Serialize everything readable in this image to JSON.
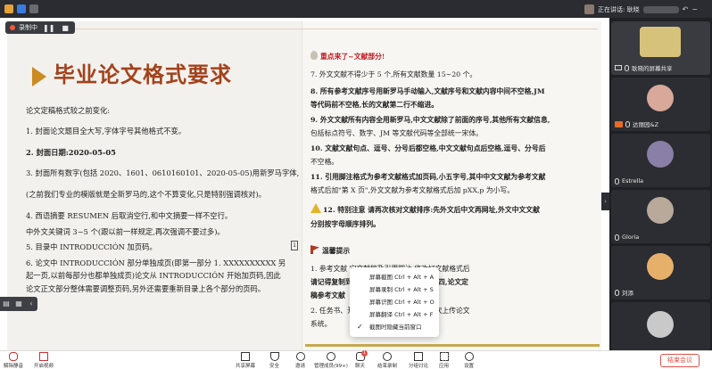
{
  "speaking": {
    "label": "正在讲话: 耿晓"
  },
  "recording": {
    "label": "录制中"
  },
  "slide": {
    "title": "毕业论文格式要求",
    "left_lines": [
      "论文定稿格式较之前变化:",
      "1. 封面论文题目全大写,字体字号其他格式不变。",
      "2. 封面日期:2020-05-05",
      "3. 封面所有数字(包括 2020、1601、0610160101、2020-05-05)用新罗马字体,",
      "(之前我们专业的模版就是全新罗马的,这个不算变化,只是特别强调核对)。",
      "4. 西语摘要 RESUMEN 后取消空行,和中文摘要一样不空行。",
      "中外文关键词 3~5 个(跟以前一样规定,再次强调不要过多)。",
      "5. 目录中 INTRODUCCIÓN 加页码。",
      "6. 论文中 INTRODUCCIÓN 部分单独成页(即第一部分 1. XXXXXXXXXX 另",
      "起一页,以前每部分也都单独成页)论文从 INTRODUCCIÓN 开始加页码,因此",
      "论文正文部分整体需要调整页码,另外还需要重新目录上各个部分的页码。"
    ],
    "page_mark": "1",
    "right_header": "重点来了~文献部分!",
    "right_lines": [
      "7. 外文文献不得少于 5 个,所有文献数量 15~20 个。",
      "8. 所有参考文献序号用新罗马手动输入,文献序号和文献内容中间不空格,JM",
      "等代码前不空格,长的文献第二行不缩进。",
      "9. 外文文献所有内容全用新罗马,中文文献除了前面的序号,其他所有文献信息,",
      "包括标点符号、数字、JM 等文献代码等全部统一宋体。",
      "10. 文献文献句点、逗号、分号后都空格,中文文献句点后空格,逗号、分号后",
      "不空格。",
      "11. 引用脚注格式为参考文献格式加页码,小五字号,其中中文文献为参考文献",
      "格式后加\"第 X 页\",外文文献为参考文献格式后加 pXX,p 为小写。",
      "12. 特别注意 请再次核对文献排序:先外文后中文再网址,外文中文文献",
      "分别按字母顺序排列。",
      "温馨提示",
      "1. 参考文献                                  定文献稿及引用脚注,修改好文献格式后",
      "请记得复制到                                 和开题报告参考文献字号小四,论文定",
      "稿参考文献                                   ",
      "2. 任务书、开                                修改定稿后,请将最终稿再次上传论文",
      "系统。"
    ]
  },
  "context_menu": [
    "屏幕截图 Ctrl + Alt + A",
    "屏幕录制 Ctrl + Alt + S",
    "屏幕识图 Ctrl + Alt + O",
    "屏幕翻译 Ctrl + Alt + F",
    "截图时隐藏当前窗口"
  ],
  "participants": [
    {
      "name": "耿晓的屏幕共享"
    },
    {
      "name": "达丽园&Z"
    },
    {
      "name": "Estrella"
    },
    {
      "name": "Gloria"
    },
    {
      "name": "刘添"
    }
  ],
  "toolbar": {
    "mute": "解除静音",
    "video": "开启视频",
    "share": "共享屏幕",
    "security": "安全",
    "invite": "邀请",
    "members": "管理成员(99+)",
    "chat": "聊天",
    "record": "结束录制",
    "breakout": "分组讨论",
    "apps": "应用",
    "settings": "设置",
    "leave": "结束会议",
    "chat_badge": "1"
  },
  "colors": {
    "title": "#a3421c",
    "accent_red": "#c4161c",
    "leave": "#e0524a"
  }
}
